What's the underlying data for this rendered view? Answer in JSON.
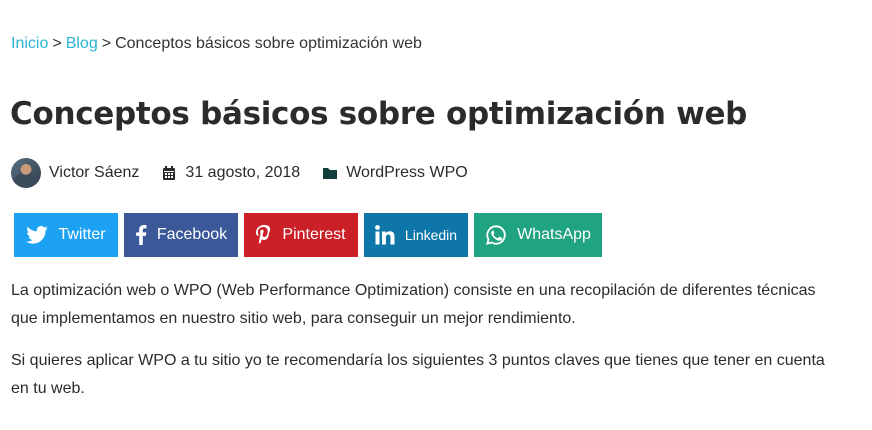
{
  "breadcrumb": {
    "home": "Inicio",
    "separator": ">",
    "blog": "Blog",
    "current": "Conceptos básicos sobre optimización web"
  },
  "post": {
    "title": "Conceptos básicos sobre optimización web",
    "author": "Victor Sáenz",
    "date": "31 agosto, 2018",
    "category": "WordPress WPO"
  },
  "share": {
    "twitter": "Twitter",
    "facebook": "Facebook",
    "pinterest": "Pinterest",
    "linkedin": "Linkedin",
    "whatsapp": "WhatsApp"
  },
  "content": {
    "paragraph_1_line_1": "La optimización web o WPO (Web Performance Optimization) consiste en una recopilación de diferentes técnicas",
    "paragraph_1_line_2": "que implementamos en nuestro sitio web, para conseguir un mejor rendimiento.",
    "paragraph_2_line_1": "Si quieres aplicar WPO a tu sitio yo te recomendaría los siguientes 3 puntos claves que tienes que tener en cuenta",
    "paragraph_2_line_2": "en tu web."
  },
  "colors": {
    "link": "#2bb3d1",
    "twitter": "#1da1f2",
    "facebook": "#3b5998",
    "pinterest": "#cb2027",
    "linkedin": "#0e76a8",
    "whatsapp": "#1fa380"
  },
  "icons": {
    "calendar": "calendar-icon",
    "folder": "folder-icon",
    "twitter": "twitter-icon",
    "facebook": "facebook-icon",
    "pinterest": "pinterest-icon",
    "linkedin": "linkedin-icon",
    "whatsapp": "whatsapp-icon"
  }
}
